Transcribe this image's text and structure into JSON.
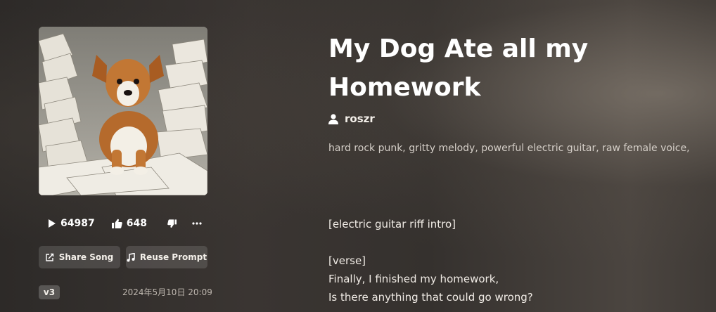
{
  "song": {
    "title": "My Dog Ate all my Homework",
    "artist": "roszr",
    "tags": "hard rock punk, gritty melody, powerful electric guitar, raw female voice,",
    "version": "v3",
    "date": "2024年5月10日 20:09"
  },
  "stats": {
    "plays": "64987",
    "likes": "648"
  },
  "buttons": {
    "share": "Share Song",
    "reuse": "Reuse Prompt"
  },
  "lyrics": {
    "intro": "[electric guitar riff intro]",
    "verse_tag": "[verse]",
    "line1": "Finally, I finished my homework,",
    "line2": "Is there anything that could go wrong?"
  },
  "icons": {
    "play": "play-icon",
    "like": "thumbs-up-icon",
    "dislike": "thumbs-down-icon",
    "more": "more-icon",
    "share": "share-icon",
    "reuse": "music-note-icon",
    "artist": "user-icon"
  },
  "colors": {
    "background": "#35312e",
    "text": "#ffffff",
    "button_bg": "#4a4542"
  }
}
